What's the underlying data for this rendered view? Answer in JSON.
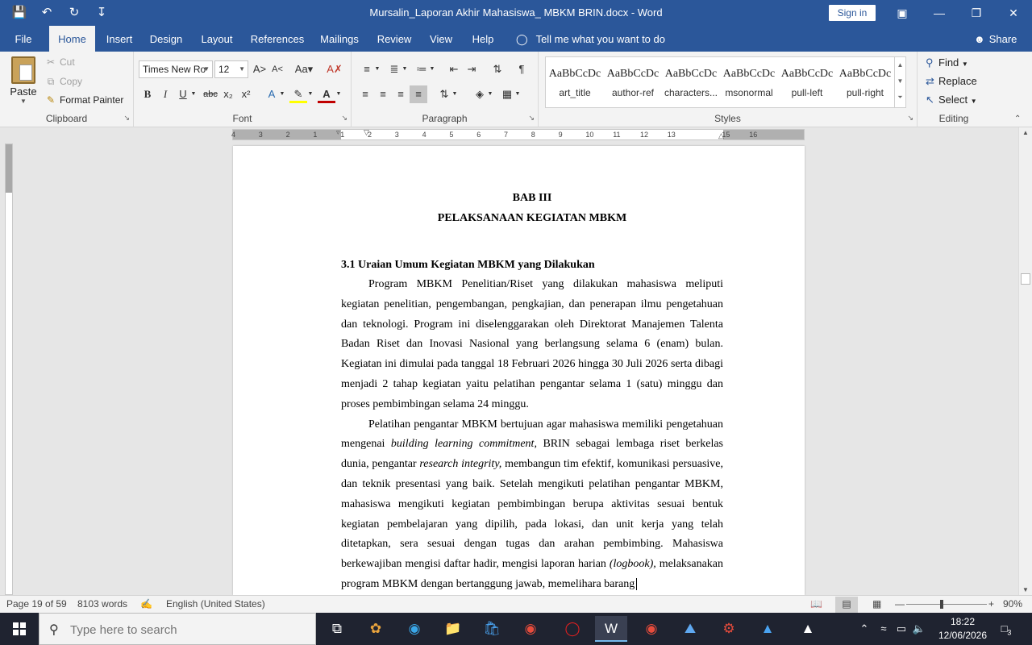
{
  "titlebar": {
    "title": "Mursalin_Laporan Akhir Mahasiswa_ MBKM BRIN.docx  -  Word",
    "signin": "Sign in"
  },
  "menu": {
    "file": "File",
    "home": "Home",
    "insert": "Insert",
    "design": "Design",
    "layout": "Layout",
    "references": "References",
    "mailings": "Mailings",
    "review": "Review",
    "view": "View",
    "help": "Help",
    "tell": "Tell me what you want to do",
    "share": "Share"
  },
  "clipboard": {
    "paste": "Paste",
    "cut": "Cut",
    "copy": "Copy",
    "format_painter": "Format Painter",
    "label": "Clipboard"
  },
  "font": {
    "name": "Times New Ro",
    "size": "12",
    "label": "Font"
  },
  "paragraph": {
    "label": "Paragraph"
  },
  "styles": {
    "label": "Styles",
    "preview": "AaBbCcDc",
    "items": [
      "art_title",
      "author-ref",
      "characters...",
      "msonormal",
      "pull-left",
      "pull-right"
    ]
  },
  "editing": {
    "find": "Find",
    "replace": "Replace",
    "select": "Select",
    "label": "Editing"
  },
  "ruler": {
    "numbers": [
      "4",
      "3",
      "2",
      "1",
      "1",
      "2",
      "3",
      "4",
      "5",
      "6",
      "7",
      "8",
      "9",
      "10",
      "11",
      "12",
      "13",
      "15",
      "16"
    ]
  },
  "document": {
    "heading1": "BAB III",
    "heading2": "PELAKSANAAN KEGIATAN MBKM",
    "subheading": "3.1 Uraian Umum Kegiatan MBKM yang Dilakukan",
    "para1": "Program MBKM Penelitian/Riset yang dilakukan mahasiswa meliputi kegiatan penelitian, pengembangan, pengkajian, dan penerapan ilmu pengetahuan dan teknologi. Program ini diselenggarakan oleh Direktorat Manajemen Talenta Badan Riset dan Inovasi Nasional yang berlangsung selama 6 (enam) bulan. Kegiatan ini dimulai pada tanggal 18 Februari 2026  hingga 30 Juli 2026 serta dibagi menjadi 2 tahap kegiatan yaitu pelatihan pengantar selama 1 (satu) minggu dan proses pembimbingan selama 24 minggu.",
    "para2_a": "Pelatihan pengantar MBKM bertujuan agar mahasiswa memiliki pengetahuan mengenai ",
    "para2_b": "building learning commitment,",
    "para2_c": " BRIN sebagai lembaga riset berkelas dunia, pengantar ",
    "para2_d": "research integrity,",
    "para2_e": " membangun tim efektif, komunikasi persuasive, dan teknik presentasi yang baik. Setelah mengikuti pelatihan pengantar MBKM, mahasiswa mengikuti kegiatan pembimbingan berupa aktivitas sesuai bentuk kegiatan pembelajaran yang dipilih, pada lokasi, dan unit kerja yang telah ditetapkan, sera sesuai dengan tugas dan arahan pembimbing. Mahasiswa berkewajiban mengisi daftar hadir, mengisi laporan harian ",
    "para2_f": "(logbook),",
    "para2_g": " melaksanakan program MBKM dengan bertanggung jawab, memelihara barang"
  },
  "status": {
    "page": "Page 19 of 59",
    "words": "8103 words",
    "language": "English (United States)",
    "zoom": "90%"
  },
  "taskbar": {
    "search_placeholder": "Type here to search",
    "time": "18:22",
    "date": "12/06/2026",
    "notifications": "3"
  }
}
